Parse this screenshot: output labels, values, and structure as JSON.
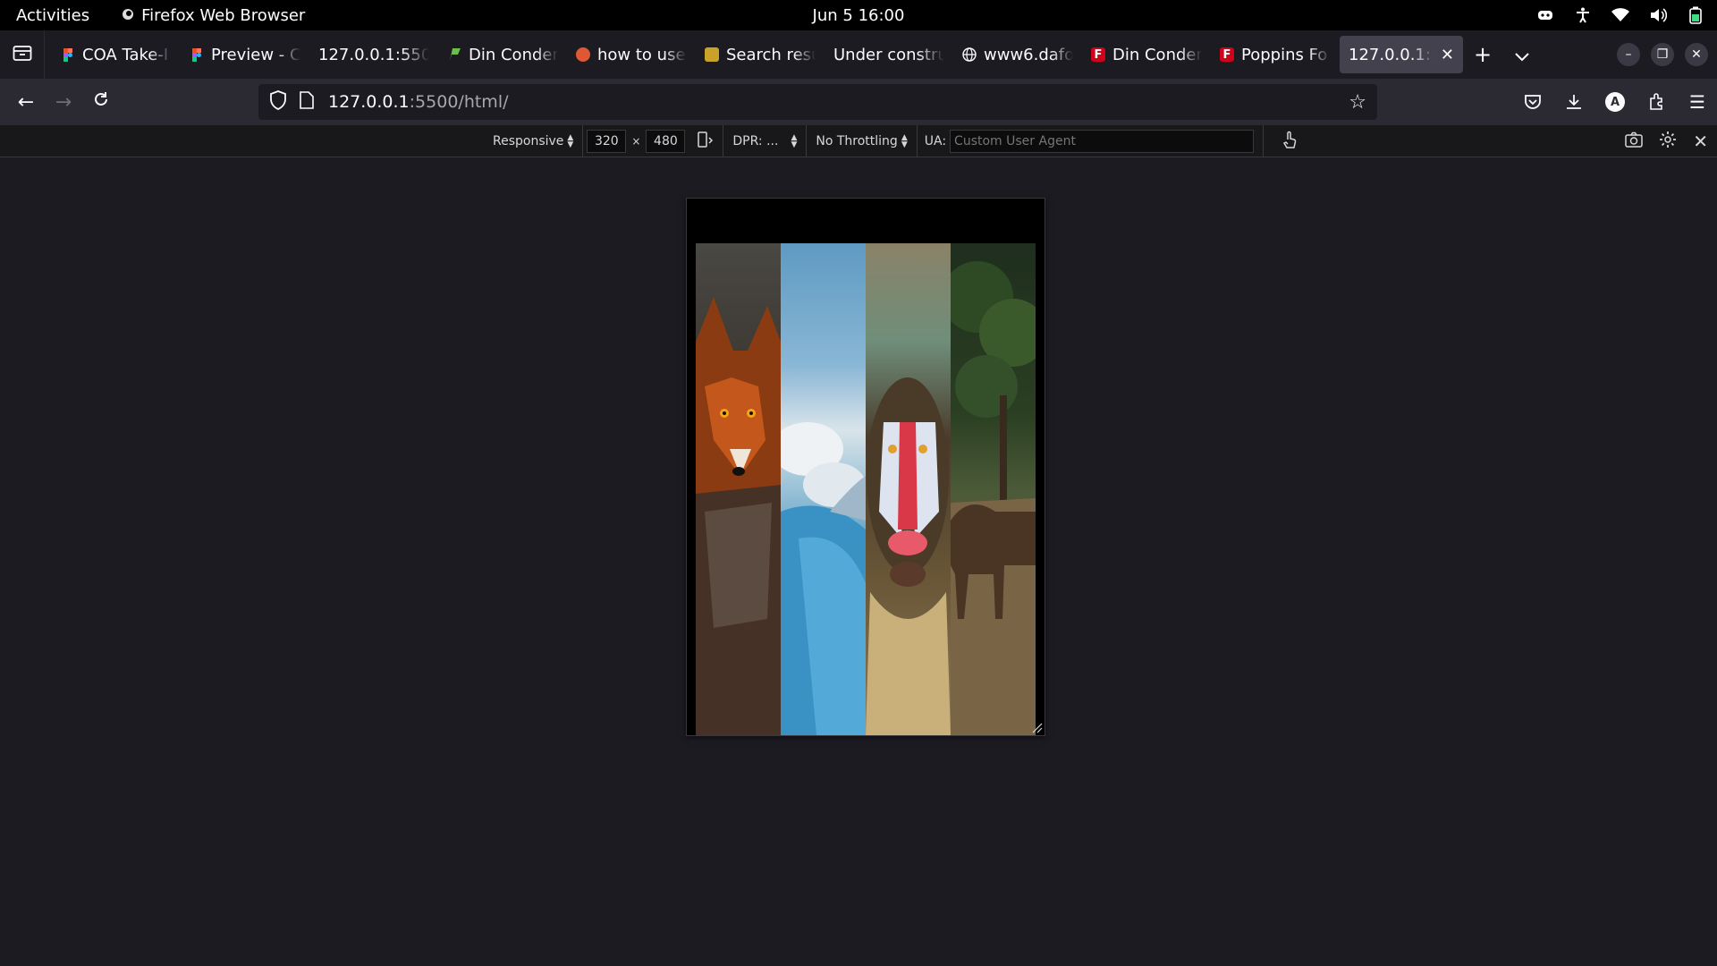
{
  "system": {
    "activities": "Activities",
    "app_name": "Firefox Web Browser",
    "clock": "Jun 5  16:00"
  },
  "tabs": [
    {
      "label": "COA Take-I",
      "favicon": "figma-icon",
      "color": "#f24e1e"
    },
    {
      "label": "Preview - C",
      "favicon": "figma-icon",
      "color": "#a259ff"
    },
    {
      "label": "127.0.0.1:5500",
      "favicon": "",
      "color": ""
    },
    {
      "label": "Din Conder",
      "favicon": "flag-icon",
      "color": "#6cc04a"
    },
    {
      "label": "how to use",
      "favicon": "duckduckgo-icon",
      "color": "#de5833"
    },
    {
      "label": "Search resu",
      "favicon": "image-icon",
      "color": "#c9a227"
    },
    {
      "label": "Under constru",
      "favicon": "",
      "color": ""
    },
    {
      "label": "www6.dafo",
      "favicon": "globe-icon",
      "color": "#fbfbfe"
    },
    {
      "label": "Din Conder",
      "favicon": "f-icon",
      "color": "#d0021b"
    },
    {
      "label": "Poppins Fo",
      "favicon": "f-icon",
      "color": "#d0021b"
    },
    {
      "label": "127.0.0.1:55",
      "favicon": "",
      "color": "",
      "active": true
    }
  ],
  "navbar": {
    "url_host": "127.0.0.1",
    "url_rest": ":5500/html/",
    "avatar_letter": "A"
  },
  "rdm": {
    "device": "Responsive",
    "width": "320",
    "height": "480",
    "dpr": "DPR: ...",
    "throttling": "No Throttling",
    "ua_label": "UA:",
    "ua_placeholder": "Custom User Agent"
  },
  "gallery": {
    "panels": [
      "fox",
      "whale",
      "mandrill",
      "horse"
    ]
  },
  "colors": {
    "chrome_dark": "#1c1b22",
    "toolbar": "#2b2a33",
    "active_tab": "#42414d",
    "rdm_bg": "#18181a"
  }
}
